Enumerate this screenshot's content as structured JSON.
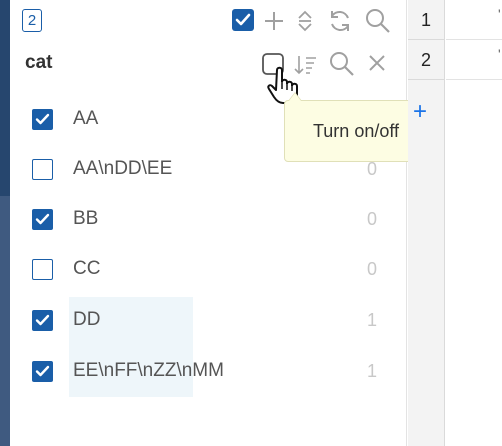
{
  "filter_panel": {
    "selected_count": "2",
    "field_name": "cat",
    "items": [
      {
        "label": "AA",
        "count": "",
        "checked": true
      },
      {
        "label": "AA\\nDD\\EE",
        "count": "0",
        "checked": false
      },
      {
        "label": "BB",
        "count": "0",
        "checked": true
      },
      {
        "label": "CC",
        "count": "0",
        "checked": false
      },
      {
        "label": "DD",
        "count": "1",
        "checked": true
      },
      {
        "label": "EE\\nFF\\nZZ\\nMM",
        "count": "1",
        "checked": true
      }
    ],
    "tooltip": "Turn on/off"
  },
  "grid": {
    "rows": [
      {
        "num": "1",
        "cell": "'"
      },
      {
        "num": "2",
        "cell": "'"
      }
    ],
    "add_icon": "+"
  },
  "colors": {
    "accent": "#1a5ea8",
    "sidebar": "#3f5a80",
    "tooltip_bg": "#fdfde3",
    "row_highlight": "#eef6fa"
  },
  "icons": [
    "checkbox-checked-icon",
    "plus-icon",
    "sort-updown-icon",
    "refresh-icon",
    "search-icon",
    "checkbox-empty-icon",
    "sort-desc-icon",
    "close-icon",
    "hand-pointer-icon"
  ]
}
